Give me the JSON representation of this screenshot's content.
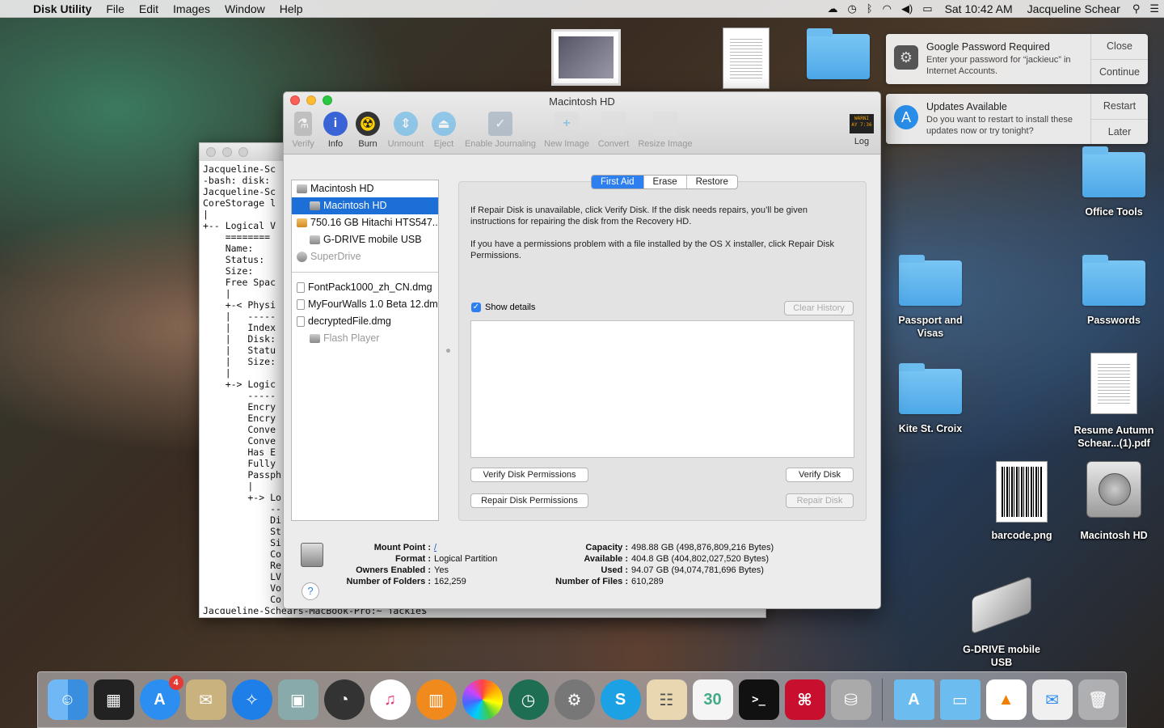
{
  "menubar": {
    "app": "Disk Utility",
    "items": [
      "File",
      "Edit",
      "Images",
      "Window",
      "Help"
    ],
    "time": "Sat 10:42 AM",
    "user": "Jacqueline Schear"
  },
  "notifications": [
    {
      "title": "Google Password Required",
      "text": "Enter your password for “jackieuc” in Internet Accounts.",
      "btn1": "Close",
      "btn2": "Continue"
    },
    {
      "title": "Updates Available",
      "text": "Do you want to restart to install these updates now or try tonight?",
      "btn1": "Restart",
      "btn2": "Later"
    }
  ],
  "desktop": {
    "office_tools": "Office Tools",
    "passport": "Passport and Visas",
    "passwords": "Passwords",
    "kite": "Kite St. Croix",
    "resume": "Resume Autumn Schear...(1).pdf",
    "barcode": "barcode.png",
    "mac_hd": "Macintosh HD",
    "gdrive": "G-DRIVE mobile USB"
  },
  "terminal": {
    "lines": "Jacqueline-Sc\n-bash: disk:\nJacqueline-Sc\nCoreStorage l\n|\n+-- Logical V\n    ========\n    Name:\n    Status:\n    Size:\n    Free Spac\n    |\n    +-< Physi\n    |   -----\n    |   Index\n    |   Disk:\n    |   Statu\n    |   Size:\n    |\n    +-> Logic\n        -----\n        Encry\n        Encry\n        Conve\n        Conve\n        Has E\n        Fully\n        Passph\n        |\n        +-> Lo\n            --\n            Di\n            St\n            Si\n            Co\n            Re\n            LV\n            Vo\n            Co\nJacqueline-Schears-MacBook-Pro:~ jackie$ "
  },
  "du": {
    "title": "Macintosh HD",
    "tools": {
      "verify": "Verify",
      "info": "Info",
      "burn": "Burn",
      "unmount": "Unmount",
      "eject": "Eject",
      "journaling": "Enable Journaling",
      "new_image": "New Image",
      "convert": "Convert",
      "resize": "Resize Image",
      "log": "Log",
      "log_icon_text": "WARNI\nAY 7:36"
    },
    "sidebar": {
      "items": [
        "Macintosh HD",
        "Macintosh HD",
        "750.16 GB Hitachi HTS547...",
        "G-DRIVE mobile USB",
        "SuperDrive",
        "FontPack1000_zh_CN.dmg",
        "MyFourWalls 1.0 Beta 12.dmg",
        "decryptedFile.dmg",
        "Flash Player"
      ]
    },
    "tabs": [
      "First Aid",
      "Erase",
      "Restore"
    ],
    "para1": "If Repair Disk is unavailable, click Verify Disk. If the disk needs repairs, you’ll be given instructions for repairing the disk from the Recovery HD.",
    "para2": "If you have a permissions problem with a file installed by the OS X installer, click Repair Disk Permissions.",
    "show_details": "Show details",
    "clear_history": "Clear History",
    "verify_perms": "Verify Disk Permissions",
    "verify_disk": "Verify Disk",
    "repair_perms": "Repair Disk Permissions",
    "repair_disk": "Repair Disk",
    "info": {
      "mount_point_k": "Mount Point :",
      "mount_point_v": "/",
      "format_k": "Format :",
      "format_v": "Logical Partition",
      "owners_k": "Owners Enabled :",
      "owners_v": "Yes",
      "folders_k": "Number of Folders :",
      "folders_v": "162,259",
      "capacity_k": "Capacity :",
      "capacity_v": "498.88 GB (498,876,809,216 Bytes)",
      "available_k": "Available :",
      "available_v": "404.8 GB (404,802,027,520 Bytes)",
      "used_k": "Used :",
      "used_v": "94.07 GB (94,074,781,696 Bytes)",
      "files_k": "Number of Files :",
      "files_v": "610,289"
    }
  },
  "dock": {
    "appstore_badge": "4"
  }
}
